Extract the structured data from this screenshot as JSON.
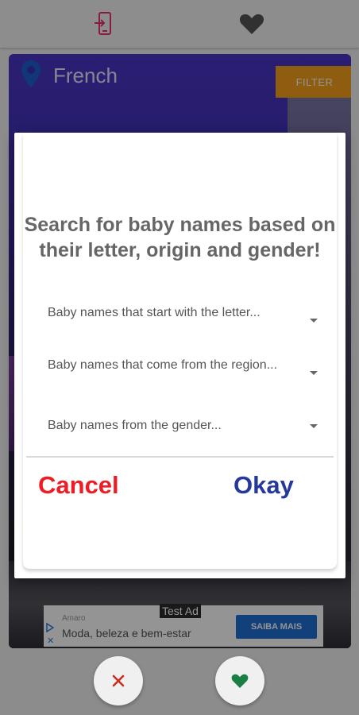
{
  "card": {
    "title": "French",
    "filter_label": "FILTER"
  },
  "ad": {
    "badge": "Test Ad",
    "brand": "Amaro",
    "text": "Moda, beleza e bem-estar",
    "cta": "SAIBA MAIS"
  },
  "dialog": {
    "title": "Search for baby names based on their letter, origin and gender!",
    "dropdowns": [
      {
        "label": "Baby names that start with the letter..."
      },
      {
        "label": "Baby names that come from the region..."
      },
      {
        "label": "Baby names from the gender..."
      }
    ],
    "cancel_label": "Cancel",
    "okay_label": "Okay"
  },
  "colors": {
    "accent_pink": "#e8336b",
    "cancel_red": "#ee1c24",
    "okay_blue": "#25399d",
    "filter_orange": "#f4a11a",
    "like_green": "#1e8e4a",
    "dislike_red": "#d4321f"
  },
  "icons": {
    "top_left": "phone-swap-icon",
    "top_right": "heart-icon",
    "card_pin": "location-pin-icon",
    "dislike": "close-icon",
    "like": "heart-icon"
  }
}
